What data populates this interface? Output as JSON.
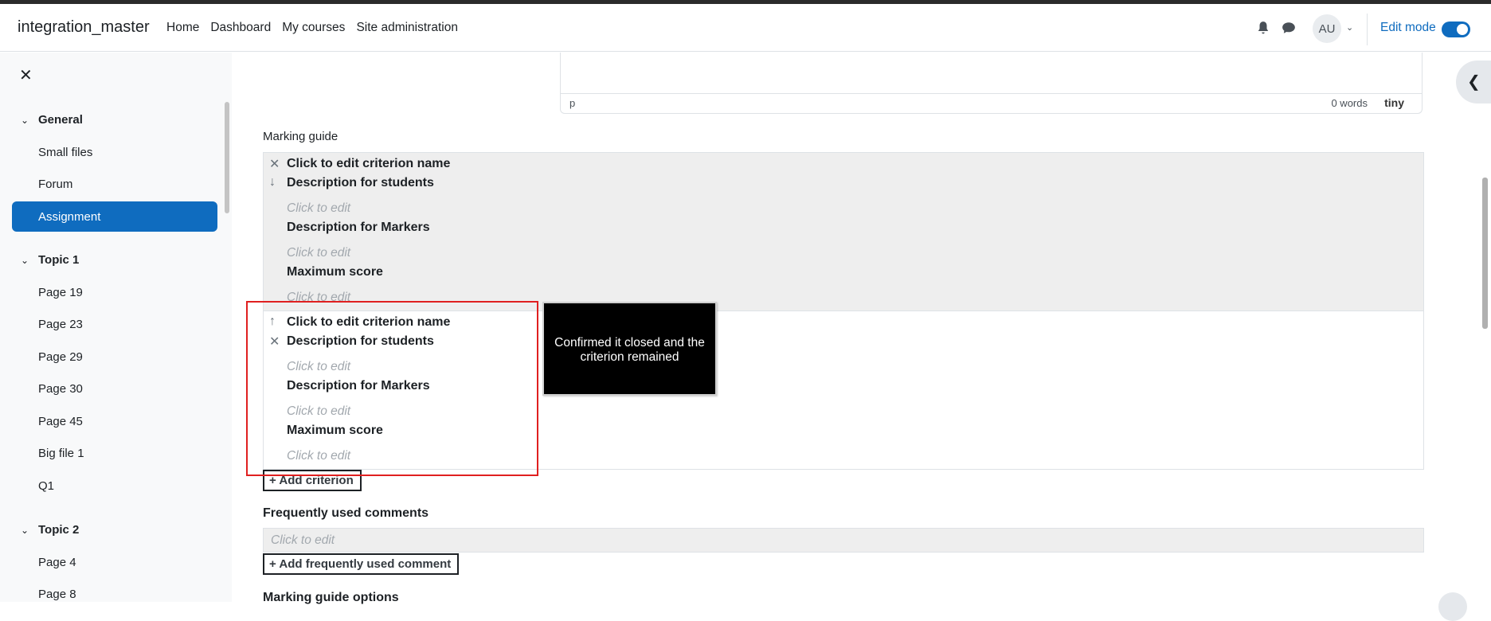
{
  "navbar": {
    "brand": "integration_master",
    "links": [
      "Home",
      "Dashboard",
      "My courses",
      "Site administration"
    ],
    "avatar_initials": "AU",
    "edit_mode_label": "Edit mode",
    "edit_mode_on": true
  },
  "sidebar": {
    "sections": [
      {
        "title": "General",
        "items": [
          "Small files",
          "Forum",
          "Assignment"
        ]
      },
      {
        "title": "Topic 1",
        "items": [
          "Page 19",
          "Page 23",
          "Page 29",
          "Page 30",
          "Page 45",
          "Big file 1",
          "Q1"
        ]
      },
      {
        "title": "Topic 2",
        "items": [
          "Page 4",
          "Page 8"
        ]
      }
    ],
    "active_item": "Assignment"
  },
  "editor": {
    "path": "p",
    "word_count": "0 words",
    "brand": "tiny"
  },
  "marking_guide": {
    "label": "Marking guide",
    "criteria": [
      {
        "name": "Click to edit criterion name",
        "desc_students_label": "Description for students",
        "desc_students_value": "Click to edit",
        "desc_markers_label": "Description for Markers",
        "desc_markers_value": "Click to edit",
        "max_score_label": "Maximum score",
        "max_score_value": "Click to edit"
      },
      {
        "name": "Click to edit criterion name",
        "desc_students_label": "Description for students",
        "desc_students_value": "Click to edit",
        "desc_markers_label": "Description for Markers",
        "desc_markers_value": "Click to edit",
        "max_score_label": "Maximum score",
        "max_score_value": "Click to edit"
      }
    ],
    "add_criterion": "Add criterion"
  },
  "frequently_used": {
    "title": "Frequently used comments",
    "placeholder": "Click to edit",
    "add_button": "Add frequently used comment"
  },
  "options_title": "Marking guide options",
  "annotation": {
    "text": "Confirmed it closed and the criterion remained",
    "color": "#e02020"
  }
}
